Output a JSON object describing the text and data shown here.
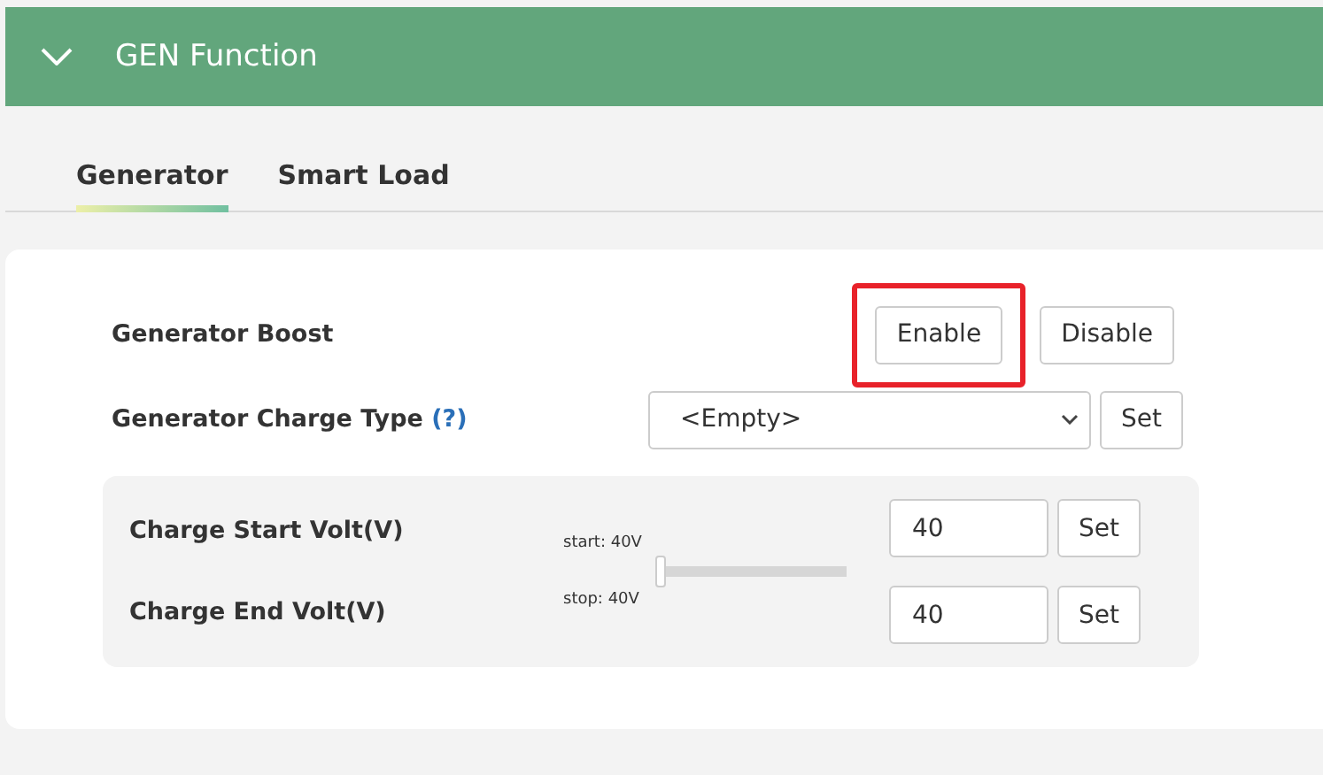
{
  "header": {
    "title": "GEN Function",
    "expanded": true
  },
  "tabs": [
    {
      "label": "Generator",
      "selected": true
    },
    {
      "label": "Smart Load",
      "selected": false
    }
  ],
  "boost": {
    "label": "Generator Boost",
    "buttons": [
      {
        "label": "Enable",
        "highlighted": true
      },
      {
        "label": "Disable",
        "highlighted": false
      }
    ]
  },
  "charge_type": {
    "label": "Generator Charge Type",
    "help": "(?)",
    "value": "<Empty>",
    "button": "Set"
  },
  "volts": {
    "start_label": "Charge Start Volt(V)",
    "end_label": "Charge End Volt(V)",
    "start_reading": "start: 40V",
    "stop_reading": "stop: 40V",
    "level": 0,
    "start_value": "40",
    "end_value": "40",
    "button_start": "Set",
    "button_end": "Set"
  }
}
